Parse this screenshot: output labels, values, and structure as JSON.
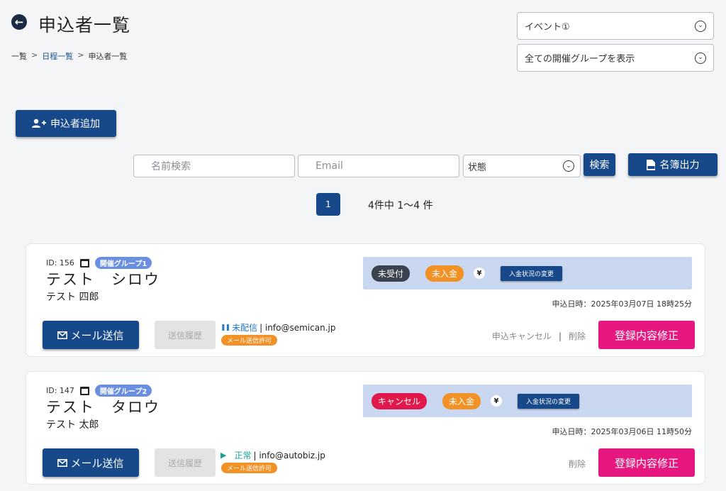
{
  "header": {
    "title": "申込者一覧",
    "breadcrumb": {
      "first": "一覧",
      "sep": ">",
      "link": "日程一覧",
      "current": "申込者一覧"
    }
  },
  "filters": {
    "event_select": "イベント①",
    "group_select": "全ての開催グループを表示"
  },
  "toolbar": {
    "add_label": "申込者追加",
    "name_placeholder": "名前検索",
    "email_placeholder": "Email",
    "status_select": "状態",
    "search_label": "検索",
    "export_label": "名簿出力"
  },
  "pagination": {
    "current_page": "1",
    "summary": "4件中 1〜4 件"
  },
  "applicants": [
    {
      "id_label": "ID: 156",
      "group": "開催グループ1",
      "kana_name": "テスト　シロウ",
      "kanji_name": "テスト 四郎",
      "reception_status": "未受付",
      "payment_status": "未入金",
      "yen": "¥",
      "payment_change_label": "入金状況の変更",
      "applied_at": "申込日時：2025年03月07日 18時25分",
      "mail_button": "メール送信",
      "history_button": "送信履歴",
      "delivery_state": "未配信",
      "email": "| info@semican.jp",
      "mail_permission": "メール送信許可",
      "cancel_label": "申込キャンセル",
      "divider": "|",
      "delete_label": "削除",
      "edit_button": "登録内容修正"
    },
    {
      "id_label": "ID: 147",
      "group": "開催グループ2",
      "kana_name": "テスト　タロウ",
      "kanji_name": "テスト 太郎",
      "reception_status": "キャンセル",
      "payment_status": "未入金",
      "yen": "¥",
      "payment_change_label": "入金状況の変更",
      "applied_at": "申込日時：2025年03月06日 11時50分",
      "mail_button": "メール送信",
      "history_button": "送信履歴",
      "delivery_state": "正常",
      "email": "| info@autobiz.jp",
      "mail_permission": "メール送信許可",
      "delete_label": "削除",
      "edit_button": "登録内容修正"
    }
  ],
  "icons": {
    "back": "arrow-left-circle-icon",
    "add_user": "user-plus-icon",
    "chevron": "chevron-down-circle-icon",
    "csv": "csv-file-icon",
    "calendar": "calendar-icon",
    "mail": "envelope-icon",
    "pause": "pause-icon",
    "play": "play-icon"
  },
  "colors": {
    "primary": "#17498a",
    "edit": "#e6177f",
    "panel": "#c9d8f0",
    "orange": "#f29125",
    "cancel_red": "#e0184c",
    "group_badge": "#6b8fe0"
  }
}
